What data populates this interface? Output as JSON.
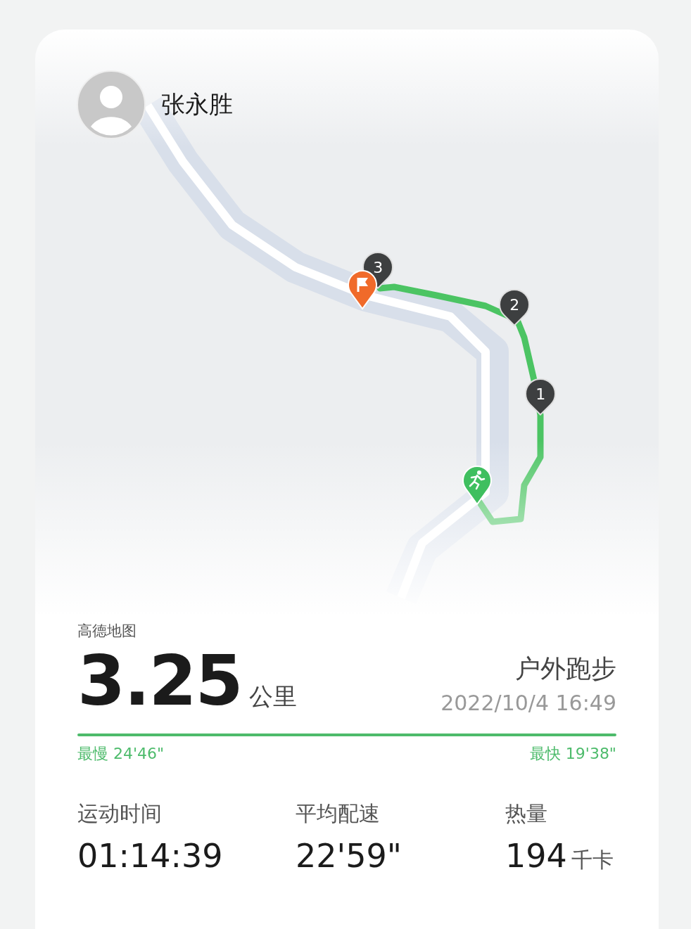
{
  "user": {
    "name": "张永胜"
  },
  "map": {
    "kind": "picture",
    "attribution": "高德地图",
    "markers": [
      {
        "kind": "km",
        "label": "3"
      },
      {
        "kind": "km",
        "label": "2"
      },
      {
        "kind": "km",
        "label": "1"
      },
      {
        "kind": "finish"
      },
      {
        "kind": "start"
      }
    ]
  },
  "summary": {
    "distance": "3.25",
    "unit": "公里",
    "activity": "户外跑步",
    "datetime": "2022/10/4 16:49"
  },
  "pace": {
    "slowest": "最慢 24'46\"",
    "fastest": "最快 19'38\""
  },
  "stats": [
    {
      "label": "运动时间",
      "value": "01:14:39"
    },
    {
      "label": "平均配速",
      "value": "22'59\""
    },
    {
      "label": "热量",
      "value": "194",
      "unit": "千卡"
    }
  ]
}
